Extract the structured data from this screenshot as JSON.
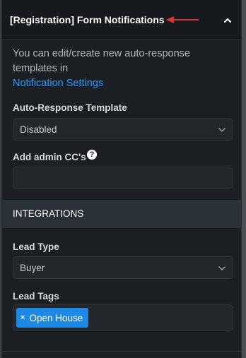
{
  "header": {
    "title": "[Registration] Form Notifications",
    "collapse_icon": "chevron-up-icon",
    "annotation_color": "#e0322a"
  },
  "intro": {
    "text": "You can edit/create new auto-response templates in",
    "link": "Notification Settings"
  },
  "auto_response": {
    "label": "Auto-Response Template",
    "value": "Disabled"
  },
  "admin_cc": {
    "label": "Add admin CC's",
    "help_icon": "question-circle-icon",
    "value": ""
  },
  "integrations": {
    "title": "INTEGRATIONS"
  },
  "lead_type": {
    "label": "Lead Type",
    "value": "Buyer"
  },
  "lead_tags": {
    "label": "Lead Tags",
    "tags": [
      {
        "label": "Open House",
        "remove": "×"
      }
    ]
  },
  "colors": {
    "panel_bg": "#1b1f24",
    "accent_link": "#2f9bff",
    "tag_bg": "#1e88e5"
  }
}
